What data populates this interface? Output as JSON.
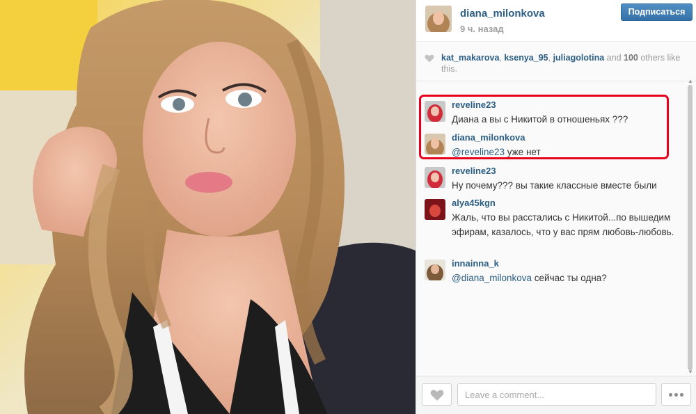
{
  "post": {
    "username": "diana_milonkova",
    "time": "9 ч. назад",
    "follow_label": "Подписаться"
  },
  "likes": {
    "users": [
      "kat_makarova",
      "ksenya_95",
      "juliagolotina"
    ],
    "sep1": ", ",
    "sep2": ", ",
    "and_text": " and ",
    "others_count": "100",
    "others_text": " others like this."
  },
  "comments": [
    {
      "username": "reveline23",
      "text": "Диана а вы с Никитой в отношеньях ???"
    },
    {
      "username": "diana_milonkova",
      "mention": "@reveline23",
      "text": " уже нет"
    },
    {
      "username": "reveline23",
      "text": "Ну почему??? вы такие классные вместе были"
    },
    {
      "username": "alya45kgn",
      "text": "Жаль, что вы расстались с Никитой...по вышедим эфирам, казалось, что у вас прям любовь-любовь."
    },
    {
      "username": "innainna_k",
      "mention": "@diana_milonkova",
      "text": " сейчас ты одна?"
    }
  ],
  "footer": {
    "comment_placeholder": "Leave a comment..."
  },
  "icons": {
    "likes": "heart-icon",
    "like_button": "heart-icon",
    "more": "ellipsis-icon"
  },
  "colors": {
    "link": "#2c5f85",
    "follow_button": "#3f7fb7",
    "highlight_border": "#e8001c"
  }
}
